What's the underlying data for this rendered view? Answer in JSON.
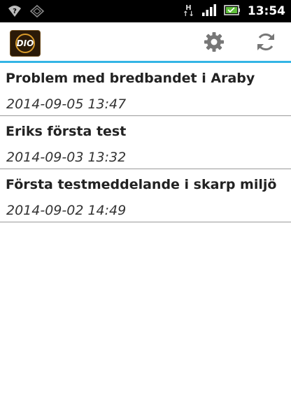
{
  "status_bar": {
    "time": "13:54",
    "network_type": "H",
    "icons": [
      "wifi-question-icon",
      "sync-off-icon",
      "network-h-icon",
      "signal-icon",
      "battery-icon"
    ]
  },
  "action_bar": {
    "logo_text": "DIO",
    "actions": [
      "settings-icon",
      "refresh-icon"
    ],
    "accent_color": "#33b5e5"
  },
  "messages": [
    {
      "title": "Problem med bredbandet i Araby",
      "date": "2014-09-05 13:47"
    },
    {
      "title": "Eriks första test",
      "date": "2014-09-03 13:32"
    },
    {
      "title": "Första testmeddelande i skarp miljö",
      "date": "2014-09-02 14:49"
    }
  ]
}
